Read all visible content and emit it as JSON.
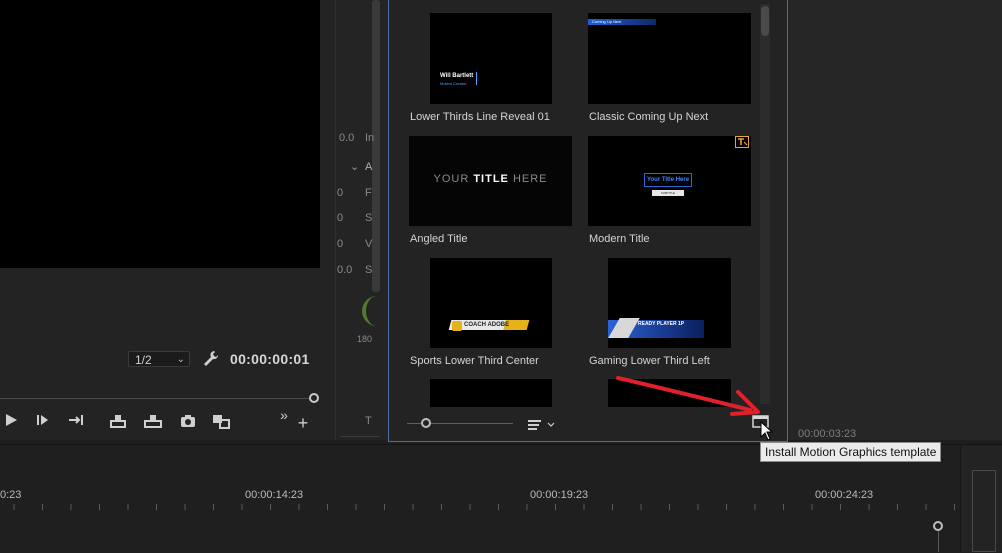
{
  "program_monitor": {
    "resolution": "1/2",
    "timecode": "00:00:00:01",
    "transport_icons": [
      "play-icon",
      "step-forward-icon",
      "go-to-out-icon",
      "lift-icon",
      "extract-icon",
      "export-frame-icon",
      "compare-icon",
      "more-icon",
      "add-button-icon"
    ]
  },
  "middle_panel": {
    "fragments": [
      "0.0",
      "In",
      "A",
      "0",
      "F",
      "0",
      "S",
      "0",
      "V",
      "0.0",
      "S",
      "180",
      "T"
    ]
  },
  "browse_panel": {
    "templates": [
      {
        "label": "Lower Thirds Line Reveal 01",
        "thumb_name": "Will Bartlett",
        "thumb_sub": "Motion Creator"
      },
      {
        "label": "Classic Coming Up Next",
        "thumb_name": "Coming Up Next",
        "thumb_sub": ""
      },
      {
        "label": "Angled Title",
        "thumb_name": "YOUR",
        "thumb_bold": "TITLE",
        "thumb_tail": "HERE"
      },
      {
        "label": "Modern Title",
        "thumb_name": "Your Title Here",
        "thumb_sub": "SUBTITLE"
      },
      {
        "label": "Sports Lower Third Center",
        "thumb_name": "COACH ADOBE",
        "thumb_sub": ""
      },
      {
        "label": "Gaming Lower Third Left",
        "thumb_name": "READY PLAYER 1P",
        "thumb_sub": ""
      }
    ],
    "badge_icon": "text-template-badge-icon"
  },
  "right_panel": {
    "timecode": "00:00:03:23"
  },
  "timeline": {
    "labels": [
      "0:23",
      "00:00:14:23",
      "00:00:19:23",
      "00:00:24:23"
    ]
  },
  "tooltip": {
    "text": "Install Motion Graphics template"
  },
  "colors": {
    "panel_border_accent": "#4a6fa5",
    "annotation_arrow": "#e0202a",
    "badge_orange": "#e8a33c"
  }
}
